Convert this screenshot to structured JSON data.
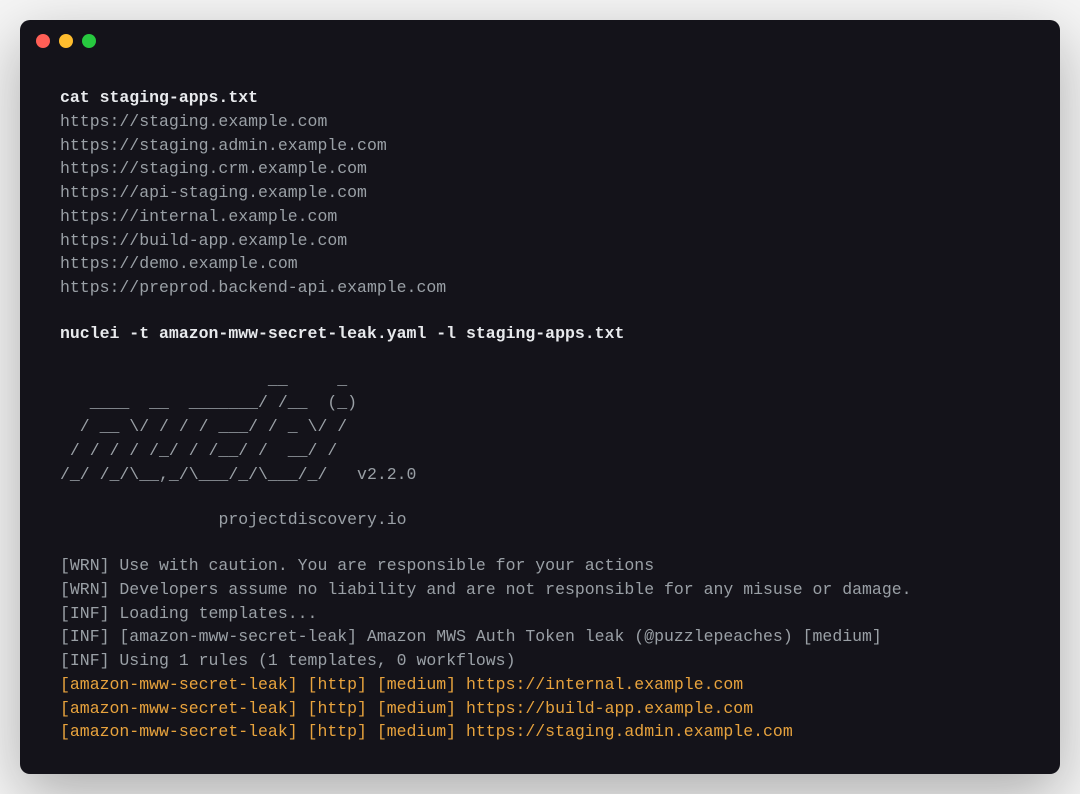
{
  "commands": {
    "cat": "cat staging-apps.txt",
    "nuclei": "nuclei -t amazon-mww-secret-leak.yaml -l staging-apps.txt"
  },
  "hosts": [
    "https://staging.example.com",
    "https://staging.admin.example.com",
    "https://staging.crm.example.com",
    "https://api-staging.example.com",
    "https://internal.example.com",
    "https://build-app.example.com",
    "https://demo.example.com",
    "https://preprod.backend-api.example.com"
  ],
  "banner": {
    "art": "                     __     _\n   ____  __  _______/ /__  (_)\n  / __ \\/ / / / ___/ / _ \\/ /\n / / / / /_/ / /__/ /  __/ /\n/_/ /_/\\__,_/\\___/_/\\___/_/   v2.2.0",
    "site": "\t\tprojectdiscovery.io"
  },
  "logs": [
    "[WRN] Use with caution. You are responsible for your actions",
    "[WRN] Developers assume no liability and are not responsible for any misuse or damage.",
    "[INF] Loading templates...",
    "[INF] [amazon-mww-secret-leak] Amazon MWS Auth Token leak (@puzzlepeaches) [medium]",
    "[INF] Using 1 rules (1 templates, 0 workflows)"
  ],
  "results": [
    "[amazon-mww-secret-leak] [http] [medium] https://internal.example.com",
    "[amazon-mww-secret-leak] [http] [medium] https://build-app.example.com",
    "[amazon-mww-secret-leak] [http] [medium] https://staging.admin.example.com"
  ]
}
